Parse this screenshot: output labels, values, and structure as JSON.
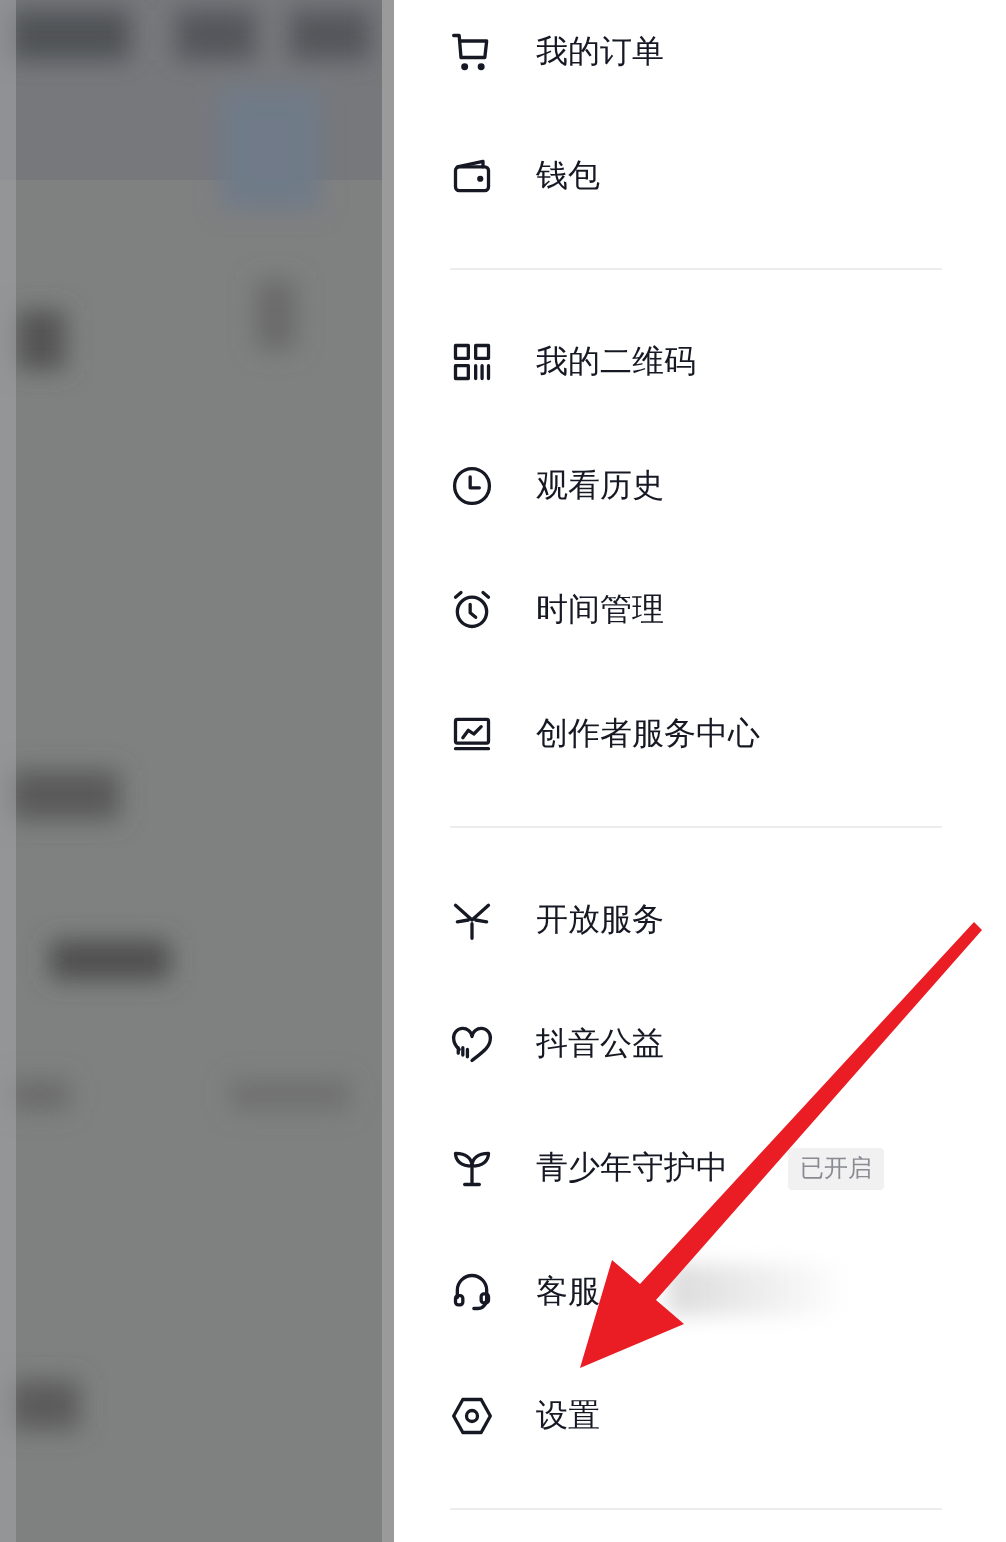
{
  "drawer": {
    "sections": [
      {
        "items": [
          {
            "kind": "cart",
            "label": "我的订单"
          },
          {
            "kind": "wallet",
            "label": "钱包"
          }
        ]
      },
      {
        "items": [
          {
            "kind": "qrcode",
            "label": "我的二维码"
          },
          {
            "kind": "clock",
            "label": "观看历史"
          },
          {
            "kind": "alarm",
            "label": "时间管理"
          },
          {
            "kind": "monitor",
            "label": "创作者服务中心"
          }
        ]
      },
      {
        "items": [
          {
            "kind": "spark",
            "label": "开放服务"
          },
          {
            "kind": "heart",
            "label": "抖音公益"
          },
          {
            "kind": "sprout",
            "label": "青少年守护中",
            "badge": "已开启"
          },
          {
            "kind": "headset",
            "label": "客服"
          },
          {
            "kind": "hexagon",
            "label": "设置"
          }
        ]
      }
    ]
  }
}
